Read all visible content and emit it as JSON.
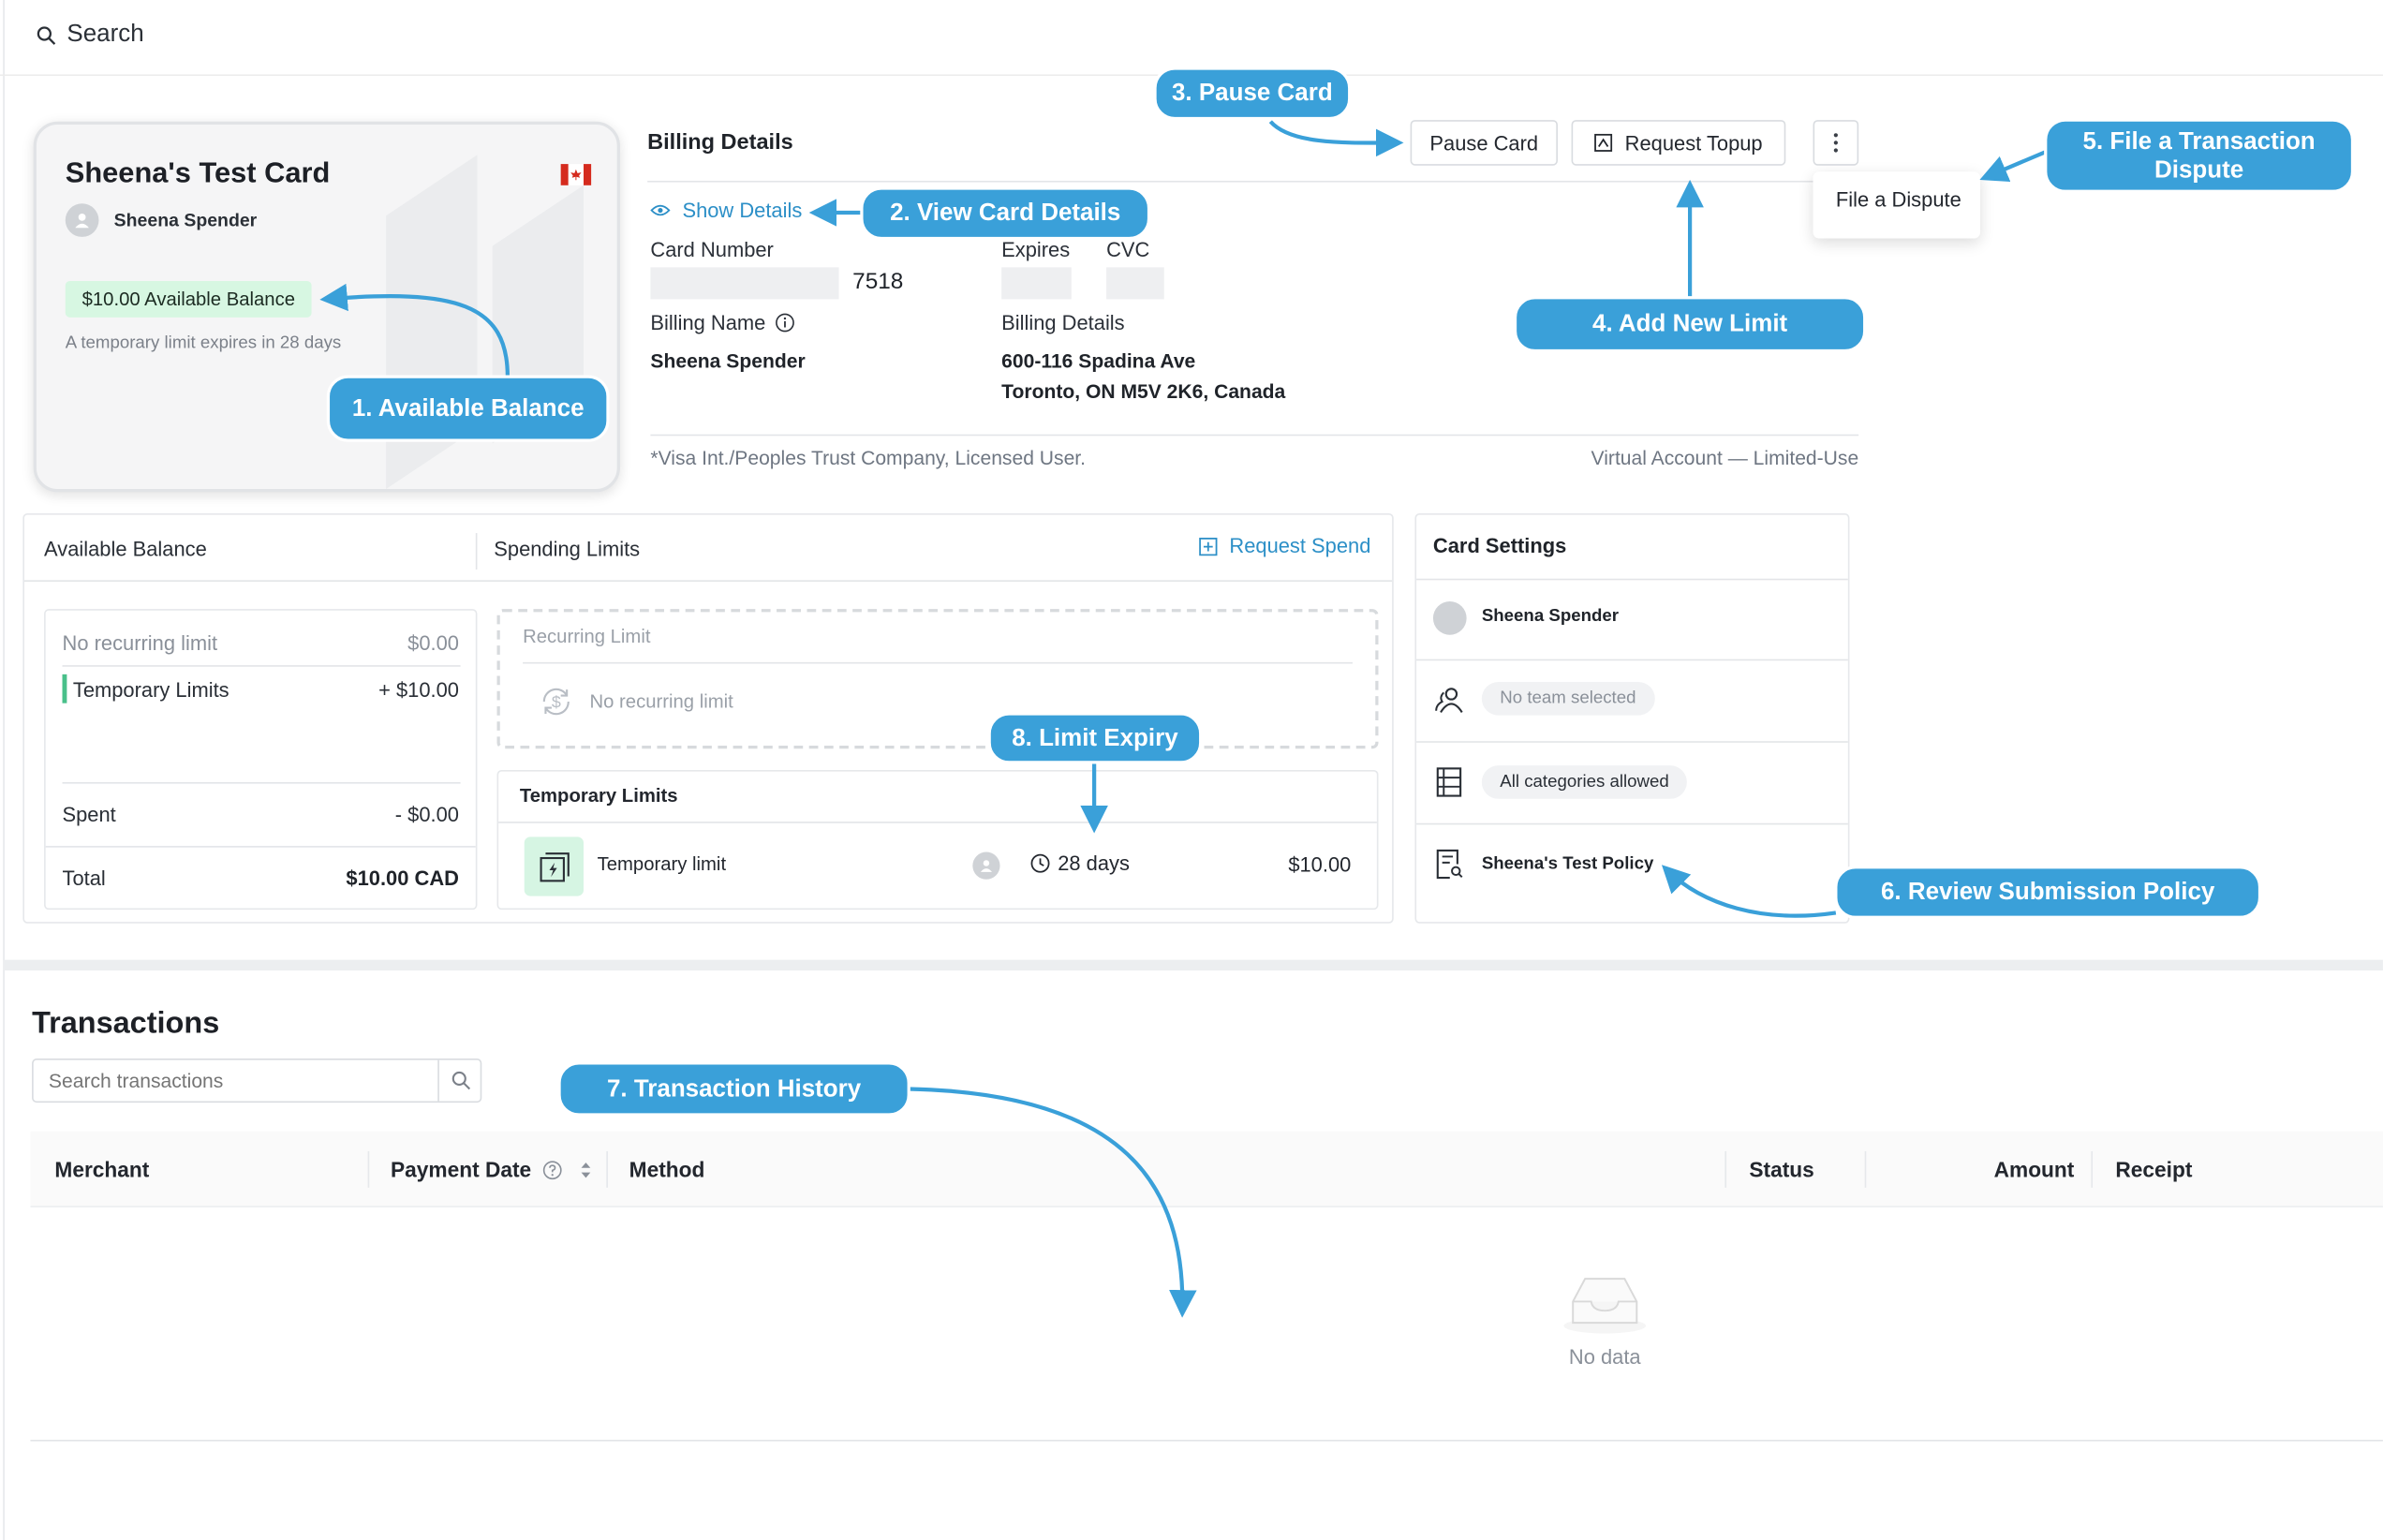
{
  "search": {
    "label": "Search"
  },
  "card": {
    "name": "Sheena's Test Card",
    "holder": "Sheena Spender",
    "available_badge": "$10.00 Available Balance",
    "expiry_note": "A temporary limit expires in 28 days",
    "flag_icon": "canada-flag-icon"
  },
  "billing": {
    "title": "Billing Details",
    "pause_label": "Pause Card",
    "topup_label": "Request Topup",
    "more_icon": "more-vertical-icon",
    "menu_item": "File a Dispute",
    "show_details": "Show Details",
    "card_number_label": "Card Number",
    "card_last4": "7518",
    "expires_label": "Expires",
    "cvc_label": "CVC",
    "billing_name_label": "Billing Name",
    "billing_name": "Sheena Spender",
    "billing_details_label": "Billing Details",
    "address_line1": "600-116 Spadina Ave",
    "address_line2": "Toronto, ON M5V 2K6, Canada",
    "footnote": "*Visa Int./Peoples Trust Company, Licensed User.",
    "account_type": "Virtual Account — Limited-Use"
  },
  "balance_panel": {
    "title": "Available Balance",
    "rows": [
      {
        "label": "No recurring limit",
        "value": "$0.00"
      },
      {
        "label": "Temporary Limits",
        "value": "+ $10.00"
      }
    ],
    "spent_label": "Spent",
    "spent_value": "- $0.00",
    "total_label": "Total",
    "total_value": "$10.00 CAD"
  },
  "limits_panel": {
    "title": "Spending Limits",
    "request_spend": "Request Spend",
    "recurring_title": "Recurring Limit",
    "recurring_empty": "No recurring limit",
    "temp_title": "Temporary Limits",
    "temp_row": {
      "name": "Temporary limit",
      "days": "28 days",
      "amount": "$10.00"
    }
  },
  "settings_panel": {
    "title": "Card Settings",
    "user": "Sheena Spender",
    "team": "No team selected",
    "categories": "All categories allowed",
    "policy": "Sheena's Test Policy"
  },
  "transactions": {
    "title": "Transactions",
    "search_placeholder": "Search transactions",
    "columns": [
      "Merchant",
      "Payment Date",
      "Method",
      "Status",
      "Amount",
      "Receipt"
    ],
    "empty": "No data"
  },
  "annotations": {
    "a1": "1. Available Balance",
    "a2": "2. View Card Details",
    "a3": "3. Pause Card",
    "a4": "4. Add New Limit",
    "a5": "5. File a Transaction Dispute",
    "a6": "6. Review Submission Policy",
    "a7": "7. Transaction History",
    "a8": "8. Limit Expiry"
  },
  "colors": {
    "accent": "#3aa0d9",
    "link": "#2c8fc7",
    "balance_badge": "#d7f7e2",
    "flag_red": "#d52b1e"
  }
}
